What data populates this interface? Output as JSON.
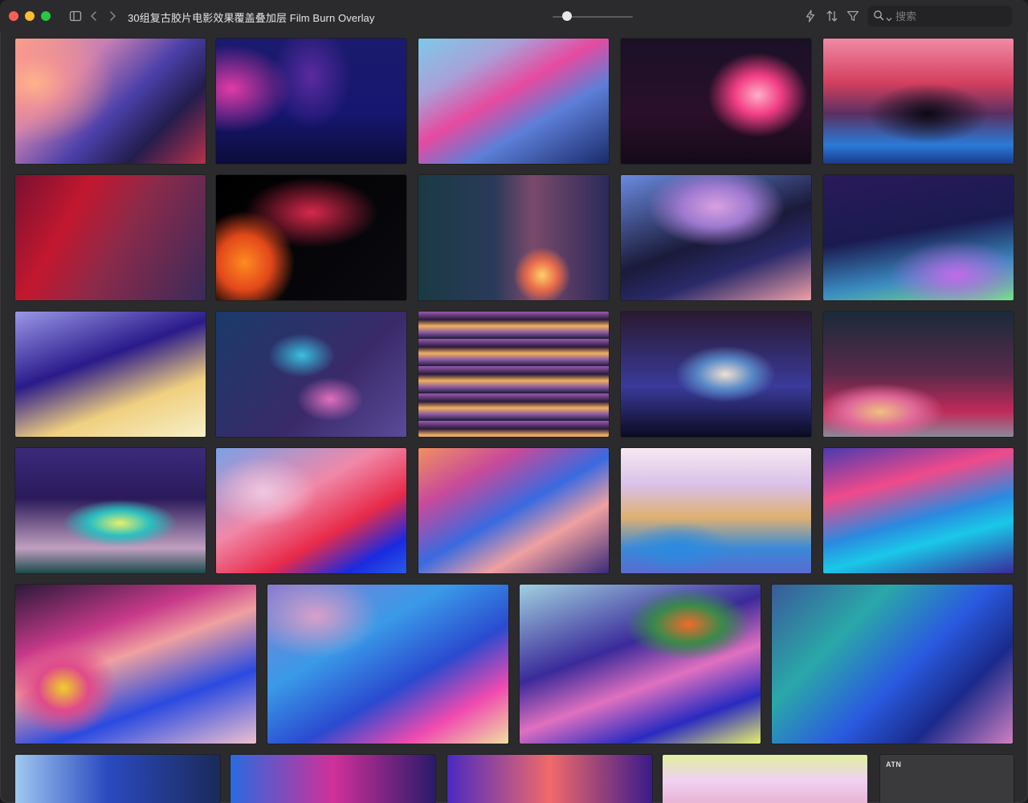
{
  "window": {
    "title": "30组复古胶片电影效果覆盖叠加层 Film Burn Overlay"
  },
  "toolbar": {
    "sidebar_toggle_icon": "sidebar-icon",
    "back_icon": "chevron-left-icon",
    "forward_icon": "chevron-right-icon",
    "thumbnail_size_slider": {
      "value": 0.18
    },
    "quick_action_icon": "lightning-icon",
    "sort_icon": "sort-icon",
    "filter_icon": "filter-icon",
    "search": {
      "placeholder": "搜索",
      "value": ""
    }
  },
  "colors": {
    "window_bg": "#2b2b2d",
    "close": "#ff5f57",
    "minimize": "#febc2e",
    "maximize": "#28c840"
  },
  "items": [
    {
      "type": "image",
      "bg": "radial-gradient(ellipse 60% 70% at 10% 35%, #ffb28a 0%, rgba(255,150,140,0.6) 30%, transparent 70%), linear-gradient(135deg, #f5a18a 0%, #c77fb3 30%, #4a3fa8 55%, #231d4c 75%, #b8324a 100%)"
    },
    {
      "type": "image",
      "bg": "radial-gradient(ellipse 45% 50% at 8% 40%, #e23aa6 0%, transparent 70%), radial-gradient(ellipse 30% 60% at 50% 30%, #5a2ba0 0%, transparent 70%), linear-gradient(180deg, #1a1a6e 0%, #161670 60%, #0c0c3a 100%)"
    },
    {
      "type": "image",
      "bg": "linear-gradient(150deg, #7ec9e8 0%, #a9a0d8 25%, #e64aa0 45%, #5d7fd8 65%, #1a2a6a 100%)"
    },
    {
      "type": "image",
      "bg": "radial-gradient(ellipse 35% 45% at 72% 45%, #ffb0c8 0%, #f23d84 35%, transparent 75%), linear-gradient(180deg, #1a1126 0%, #2a0f2a 60%, #140a18 100%)"
    },
    {
      "type": "image",
      "bg": "radial-gradient(ellipse 40% 30% at 55% 60%, #0a0a14 0%, transparent 80%), linear-gradient(180deg, #f08aa6 0%, #d43f5f 35%, #5a3060 60%, #2a7ad8 85%, #1a3a8a 100%)"
    },
    {
      "type": "image",
      "bg": "linear-gradient(120deg, #7a1030 0%, #c2182f 30%, #8a2a4a 55%, #3a2a5a 100%)"
    },
    {
      "type": "image",
      "bg": "radial-gradient(ellipse 35% 55% at 15% 70%, #ff8a20 0%, #e2481a 40%, transparent 75%), radial-gradient(ellipse 50% 40% at 50% 30%, #d8284c 0%, transparent 70%), linear-gradient(135deg, #000 0%, #0a0a10 100%)"
    },
    {
      "type": "image",
      "bg": "radial-gradient(ellipse 20% 30% at 65% 80%, #ffd06a 0%, #e86a4a 40%, transparent 75%), linear-gradient(90deg, #1a3a44 0%, #2a3a5a 40%, #7a4a6a 60%, #2a2a5a 100%)"
    },
    {
      "type": "image",
      "bg": "radial-gradient(ellipse 45% 40% at 50% 25%, #d9a0e0 0%, #9f7ad0 40%, transparent 80%), linear-gradient(160deg, #6a8ae0 0%, #1a1a3a 50%, #2a2a6a 70%, #f0a0a8 100%)"
    },
    {
      "type": "image",
      "bg": "radial-gradient(ellipse 50% 40% at 70% 80%, #c16ae8 0%, transparent 70%), linear-gradient(170deg, #2a1a5a 0%, #1a1a50 45%, #3a8ac0 75%, #7cde8a 100%)"
    },
    {
      "type": "image",
      "bg": "linear-gradient(160deg, #9a98e8 0%, #2a1a8a 40%, #f0d080 70%, #f6f0c8 100%)"
    },
    {
      "type": "image",
      "bg": "radial-gradient(ellipse 25% 25% at 45% 35%, #3ac0e0 0%, transparent 70%), radial-gradient(ellipse 25% 25% at 60% 70%, #e070c0 0%, transparent 70%), linear-gradient(135deg, #1a3a6a 0%, #3a2a6a 60%, #5a4a9a 100%)"
    },
    {
      "type": "image",
      "bg": "repeating-linear-gradient(180deg, #9a5ab0 0px, #2a1a3a 10px, #f0b060 18px, #8a5aa0 26px, #1a1a3a 34px)"
    },
    {
      "type": "image",
      "bg": "radial-gradient(ellipse 35% 30% at 55% 50%, #f0e0d0 0%, #5a8ac8 40%, transparent 75%), linear-gradient(180deg, #2a1a30 0%, #3a3a9a 60%, #0a0a20 100%)"
    },
    {
      "type": "image",
      "bg": "radial-gradient(ellipse 45% 30% at 30% 80%, #f0c080 0%, #e06a9a 40%, transparent 75%), linear-gradient(180deg, #1a2a3a 0%, #5a2a4a 50%, #c02a5a 80%, #8a8a9a 100%)"
    },
    {
      "type": "image",
      "bg": "radial-gradient(ellipse 40% 25% at 55% 60%, #e8f06a 0%, #2ac0c0 40%, transparent 75%), linear-gradient(180deg, #3a2a7a 0%, #2a1a5a 40%, #c0a0c0 80%, #1a4a4a 100%)"
    },
    {
      "type": "image",
      "bg": "radial-gradient(ellipse 40% 40% at 25% 35%, #f0c8e0 0%, transparent 70%), linear-gradient(150deg, #7aa0e8 0%, #f088a8 40%, #e82a4a 65%, #1a2ae0 85%, #2a5ae8 100%)"
    },
    {
      "type": "image",
      "bg": "linear-gradient(150deg, #f09060 0%, #c84a9a 25%, #3a6ae0 50%, #f0a0a0 70%, #3a2a7a 100%)"
    },
    {
      "type": "image",
      "bg": "radial-gradient(ellipse 40% 30% at 30% 80%, #2a8ae0 0%, transparent 70%), linear-gradient(180deg, #f6e8f0 0%, #d8c0e8 30%, #e0b070 55%, #3a8ad8 80%, #5a6ad0 100%)"
    },
    {
      "type": "image",
      "bg": "linear-gradient(165deg, #4a3ab0 0%, #f04a8a 30%, #2a8ae0 55%, #1ac8e8 70%, #3a2a9a 100%)"
    },
    {
      "type": "image",
      "bg": "radial-gradient(ellipse 30% 40% at 20% 65%, #f0d02a 0%, #e04a8a 35%, transparent 75%), linear-gradient(160deg, #2a1a3a 0%, #c83a8a 30%, #f0a0a0 45%, #2a4ae0 70%, #f0c0d0 100%)"
    },
    {
      "type": "image",
      "bg": "radial-gradient(ellipse 35% 35% at 20% 20%, #d8a0c8 0%, transparent 75%), linear-gradient(150deg, #8a7ad0 0%, #3a9ae8 35%, #2a4ad0 60%, #f04ab0 80%, #f0e0a0 100%)"
    },
    {
      "type": "image",
      "bg": "radial-gradient(ellipse 35% 30% at 70% 25%, #f06a2a 0%, #3a8a4a 40%, transparent 75%), linear-gradient(160deg, #a0d0e0 0%, #3a2a9a 40%, #e070c0 60%, #2a2ac0 80%, #e8f06a 100%)"
    },
    {
      "type": "image",
      "bg": "linear-gradient(135deg, #3a5a9a 0%, #2aa8a8 30%, #2a5ae0 55%, #1a2a8a 75%, #d080c0 100%)"
    },
    {
      "type": "image",
      "bg": "linear-gradient(90deg, #a0c8f0 0%, #2a4ac0 45%, #1a2a5a 100%)"
    },
    {
      "type": "image",
      "bg": "linear-gradient(90deg, #2a6ae0 0%, #d0309a 50%, #2a1a6a 100%)"
    },
    {
      "type": "image",
      "bg": "linear-gradient(90deg, #4a2ac0 0%, #f06a6a 50%, #3a1a8a 100%)"
    },
    {
      "type": "image",
      "bg": "linear-gradient(180deg, #e0f0a0 0%, #f0d0f0 40%, #e0a0c0 100%)"
    },
    {
      "type": "doc",
      "tag": "ATN"
    }
  ]
}
